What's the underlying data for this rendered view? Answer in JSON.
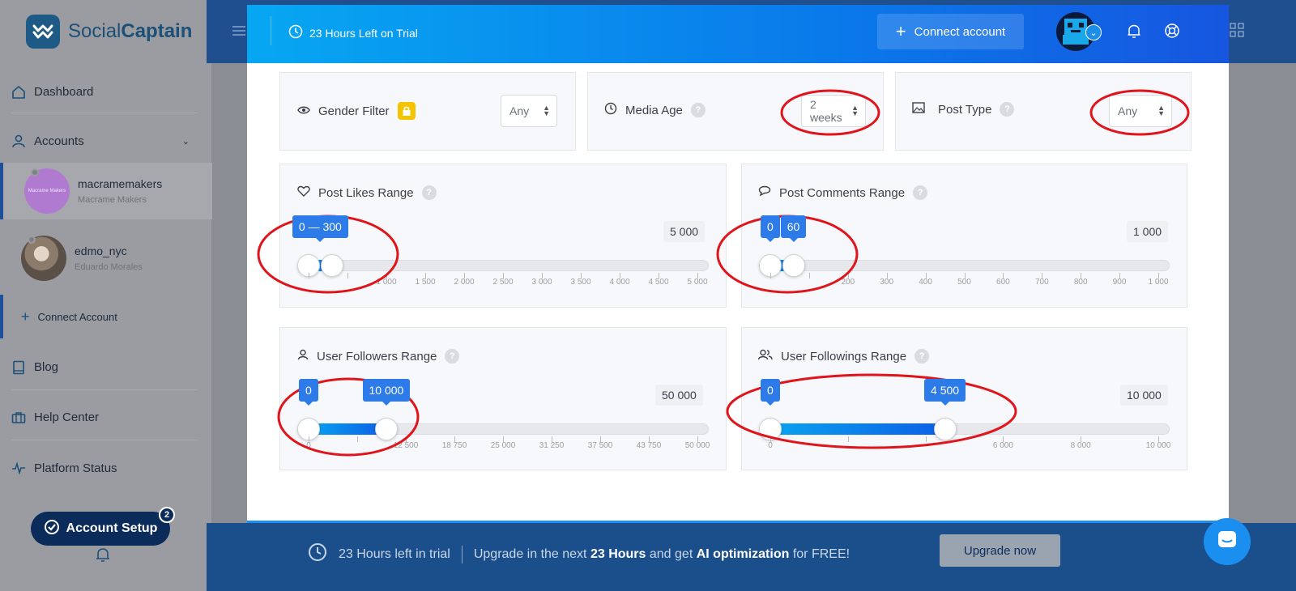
{
  "brand": {
    "name_part1": "Social",
    "name_part2": "Captain"
  },
  "sidebar": {
    "dashboard": "Dashboard",
    "accounts": "Accounts",
    "account_list": [
      {
        "username": "macramemakers",
        "name": "Macrame Makers",
        "avatar_text": "Macrame Makers"
      },
      {
        "username": "edmo_nyc",
        "name": "Eduardo Morales"
      }
    ],
    "connect_account": "Connect Account",
    "blog": "Blog",
    "help_center": "Help Center",
    "platform_status": "Platform Status",
    "account_setup": "Account Setup",
    "account_setup_badge": "2"
  },
  "topbar": {
    "trial": "23 Hours Left on Trial",
    "connect_button": "Connect account"
  },
  "filters": {
    "gender": {
      "label": "Gender Filter",
      "value": "Any"
    },
    "media_age": {
      "label": "Media Age",
      "value": "2 weeks"
    },
    "post_type": {
      "label": "Post Type",
      "value": "Any"
    }
  },
  "ranges": {
    "post_likes": {
      "label": "Post Likes Range",
      "low": 0,
      "high": 300,
      "tip": "0 — 300",
      "max_label": "5 000",
      "max": 5000,
      "ticks": [
        "",
        "",
        "1 000",
        "1 500",
        "2 000",
        "2 500",
        "3 000",
        "3 500",
        "4 000",
        "4 500",
        "5 000"
      ]
    },
    "post_comments": {
      "label": "Post Comments Range",
      "low": 0,
      "high": 60,
      "tip_low": "0",
      "tip_high": "60",
      "max_label": "1 000",
      "max": 1000,
      "ticks": [
        "",
        "",
        "200",
        "300",
        "400",
        "500",
        "600",
        "700",
        "800",
        "900",
        "1 000"
      ]
    },
    "user_followers": {
      "label": "User Followers Range",
      "low": 0,
      "high": 10000,
      "tip_low": "0",
      "tip_high": "10 000",
      "max_label": "50 000",
      "max": 50000,
      "ticks": [
        "0",
        "",
        "12 500",
        "18 750",
        "25 000",
        "31 250",
        "37 500",
        "43 750",
        "50 000"
      ]
    },
    "user_followings": {
      "label": "User Followings Range",
      "low": 0,
      "high": 4500,
      "tip_low": "0",
      "tip_high": "4 500",
      "max_label": "10 000",
      "max": 10000,
      "ticks": [
        "0",
        "",
        "",
        "6 000",
        "8 000",
        "10 000"
      ]
    }
  },
  "banner": {
    "trial": "23 Hours left in trial",
    "msg_part1": "Upgrade in the next",
    "msg_hours": "23 Hours",
    "msg_part2": "and get",
    "msg_feature": "AI optimization",
    "msg_part3": "for FREE!",
    "upgrade_button": "Upgrade now"
  },
  "colors": {
    "accent": "#2d7be8",
    "annotation": "#e0141b",
    "brand": "#1d4f77"
  },
  "icons": [
    "logo-icon",
    "menu-icon",
    "clock-icon",
    "plus-icon",
    "bell-icon",
    "lifebuoy-icon",
    "grid-icon",
    "home-icon",
    "user-icon",
    "chevron-down-icon",
    "book-icon",
    "briefcase-icon",
    "pulse-icon",
    "eye-icon",
    "lock-icon",
    "image-icon",
    "heart-icon",
    "comment-icon",
    "users-icon",
    "check-circle-icon",
    "chat-icon"
  ]
}
